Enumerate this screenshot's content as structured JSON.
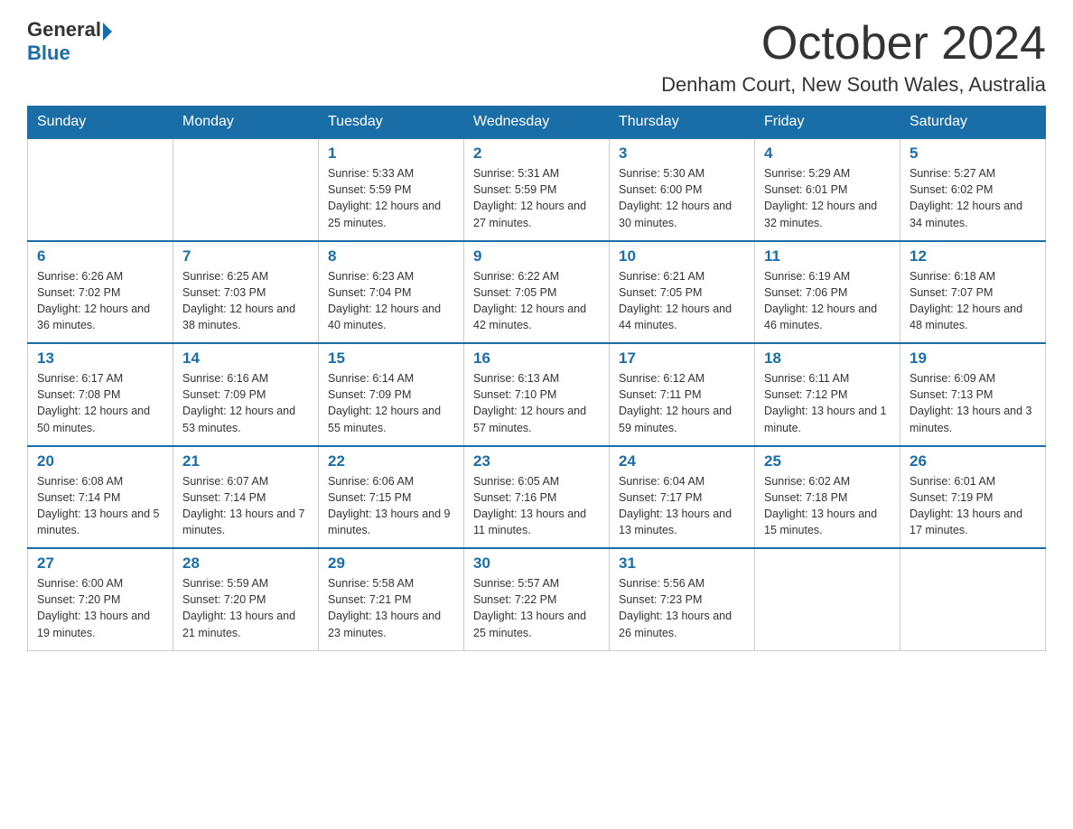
{
  "header": {
    "logo_general": "General",
    "logo_blue": "Blue",
    "month_title": "October 2024",
    "location": "Denham Court, New South Wales, Australia"
  },
  "days_of_week": [
    "Sunday",
    "Monday",
    "Tuesday",
    "Wednesday",
    "Thursday",
    "Friday",
    "Saturday"
  ],
  "weeks": [
    [
      {
        "day": "",
        "info": ""
      },
      {
        "day": "",
        "info": ""
      },
      {
        "day": "1",
        "info": "Sunrise: 5:33 AM\nSunset: 5:59 PM\nDaylight: 12 hours\nand 25 minutes."
      },
      {
        "day": "2",
        "info": "Sunrise: 5:31 AM\nSunset: 5:59 PM\nDaylight: 12 hours\nand 27 minutes."
      },
      {
        "day": "3",
        "info": "Sunrise: 5:30 AM\nSunset: 6:00 PM\nDaylight: 12 hours\nand 30 minutes."
      },
      {
        "day": "4",
        "info": "Sunrise: 5:29 AM\nSunset: 6:01 PM\nDaylight: 12 hours\nand 32 minutes."
      },
      {
        "day": "5",
        "info": "Sunrise: 5:27 AM\nSunset: 6:02 PM\nDaylight: 12 hours\nand 34 minutes."
      }
    ],
    [
      {
        "day": "6",
        "info": "Sunrise: 6:26 AM\nSunset: 7:02 PM\nDaylight: 12 hours\nand 36 minutes."
      },
      {
        "day": "7",
        "info": "Sunrise: 6:25 AM\nSunset: 7:03 PM\nDaylight: 12 hours\nand 38 minutes."
      },
      {
        "day": "8",
        "info": "Sunrise: 6:23 AM\nSunset: 7:04 PM\nDaylight: 12 hours\nand 40 minutes."
      },
      {
        "day": "9",
        "info": "Sunrise: 6:22 AM\nSunset: 7:05 PM\nDaylight: 12 hours\nand 42 minutes."
      },
      {
        "day": "10",
        "info": "Sunrise: 6:21 AM\nSunset: 7:05 PM\nDaylight: 12 hours\nand 44 minutes."
      },
      {
        "day": "11",
        "info": "Sunrise: 6:19 AM\nSunset: 7:06 PM\nDaylight: 12 hours\nand 46 minutes."
      },
      {
        "day": "12",
        "info": "Sunrise: 6:18 AM\nSunset: 7:07 PM\nDaylight: 12 hours\nand 48 minutes."
      }
    ],
    [
      {
        "day": "13",
        "info": "Sunrise: 6:17 AM\nSunset: 7:08 PM\nDaylight: 12 hours\nand 50 minutes."
      },
      {
        "day": "14",
        "info": "Sunrise: 6:16 AM\nSunset: 7:09 PM\nDaylight: 12 hours\nand 53 minutes."
      },
      {
        "day": "15",
        "info": "Sunrise: 6:14 AM\nSunset: 7:09 PM\nDaylight: 12 hours\nand 55 minutes."
      },
      {
        "day": "16",
        "info": "Sunrise: 6:13 AM\nSunset: 7:10 PM\nDaylight: 12 hours\nand 57 minutes."
      },
      {
        "day": "17",
        "info": "Sunrise: 6:12 AM\nSunset: 7:11 PM\nDaylight: 12 hours\nand 59 minutes."
      },
      {
        "day": "18",
        "info": "Sunrise: 6:11 AM\nSunset: 7:12 PM\nDaylight: 13 hours\nand 1 minute."
      },
      {
        "day": "19",
        "info": "Sunrise: 6:09 AM\nSunset: 7:13 PM\nDaylight: 13 hours\nand 3 minutes."
      }
    ],
    [
      {
        "day": "20",
        "info": "Sunrise: 6:08 AM\nSunset: 7:14 PM\nDaylight: 13 hours\nand 5 minutes."
      },
      {
        "day": "21",
        "info": "Sunrise: 6:07 AM\nSunset: 7:14 PM\nDaylight: 13 hours\nand 7 minutes."
      },
      {
        "day": "22",
        "info": "Sunrise: 6:06 AM\nSunset: 7:15 PM\nDaylight: 13 hours\nand 9 minutes."
      },
      {
        "day": "23",
        "info": "Sunrise: 6:05 AM\nSunset: 7:16 PM\nDaylight: 13 hours\nand 11 minutes."
      },
      {
        "day": "24",
        "info": "Sunrise: 6:04 AM\nSunset: 7:17 PM\nDaylight: 13 hours\nand 13 minutes."
      },
      {
        "day": "25",
        "info": "Sunrise: 6:02 AM\nSunset: 7:18 PM\nDaylight: 13 hours\nand 15 minutes."
      },
      {
        "day": "26",
        "info": "Sunrise: 6:01 AM\nSunset: 7:19 PM\nDaylight: 13 hours\nand 17 minutes."
      }
    ],
    [
      {
        "day": "27",
        "info": "Sunrise: 6:00 AM\nSunset: 7:20 PM\nDaylight: 13 hours\nand 19 minutes."
      },
      {
        "day": "28",
        "info": "Sunrise: 5:59 AM\nSunset: 7:20 PM\nDaylight: 13 hours\nand 21 minutes."
      },
      {
        "day": "29",
        "info": "Sunrise: 5:58 AM\nSunset: 7:21 PM\nDaylight: 13 hours\nand 23 minutes."
      },
      {
        "day": "30",
        "info": "Sunrise: 5:57 AM\nSunset: 7:22 PM\nDaylight: 13 hours\nand 25 minutes."
      },
      {
        "day": "31",
        "info": "Sunrise: 5:56 AM\nSunset: 7:23 PM\nDaylight: 13 hours\nand 26 minutes."
      },
      {
        "day": "",
        "info": ""
      },
      {
        "day": "",
        "info": ""
      }
    ]
  ]
}
